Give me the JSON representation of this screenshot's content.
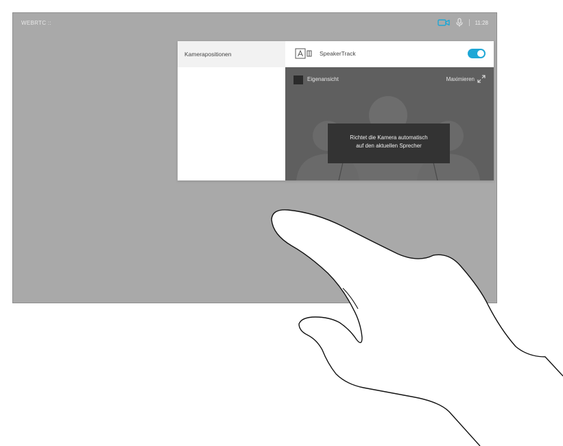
{
  "status_bar": {
    "system_name": "WEBRTC ::",
    "time": "11:28",
    "icons": [
      "video-camera-icon",
      "microphone-icon"
    ],
    "camera_icon_color": "#1ea7d6"
  },
  "camera_panel": {
    "menu": {
      "items": [
        {
          "label": "Kamerapositionen"
        }
      ]
    },
    "speakertrack": {
      "label": "SpeakerTrack",
      "enabled": true,
      "toggle_color": "#1ea7d6"
    },
    "preview": {
      "selfview_label": "Eigenansicht",
      "maximize_label": "Maximieren",
      "tooltip_lines": [
        "Richtet die Kamera automatisch",
        "auf den aktuellen Sprecher"
      ]
    }
  },
  "colors": {
    "screen_background": "#a9a9a9",
    "panel_background": "#ffffff",
    "preview_background": "#5f5f5f",
    "tooltip_background": "#333333"
  }
}
